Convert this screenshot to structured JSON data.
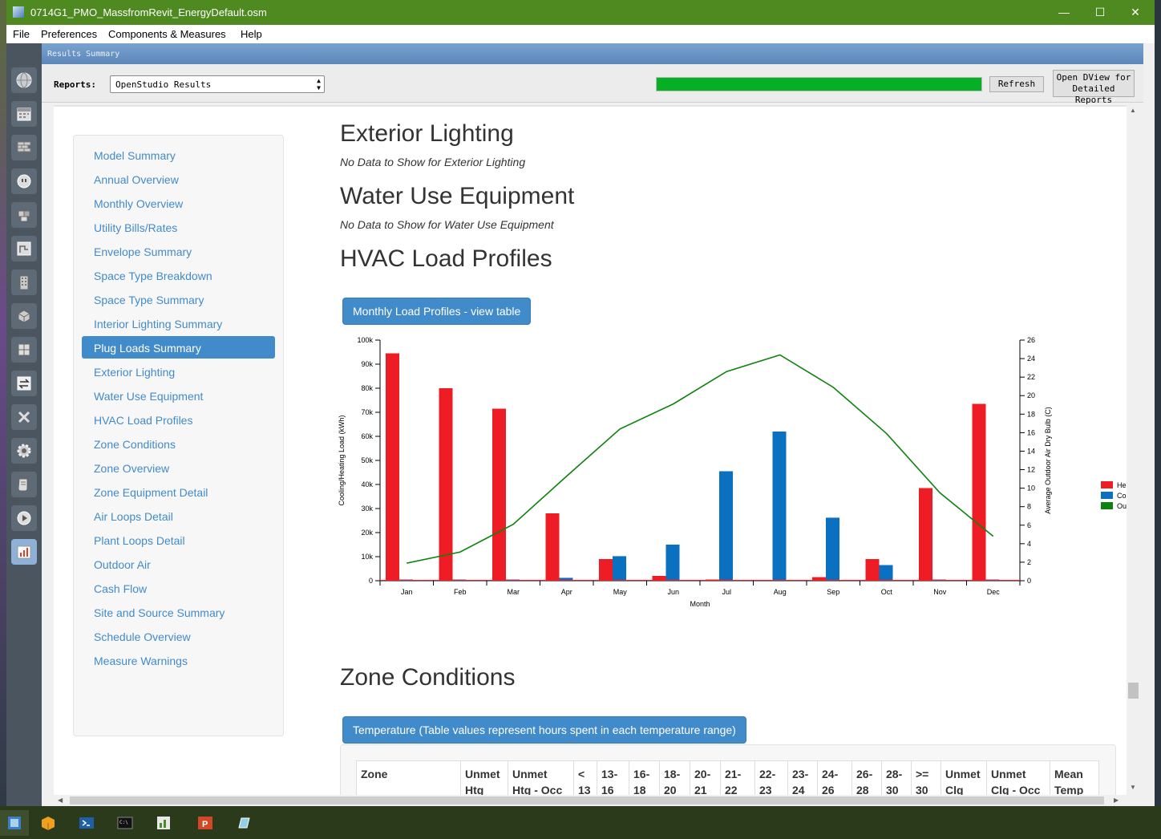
{
  "window": {
    "title": "0714G1_PMO_MassfromRevit_EnergyDefault.osm",
    "minimize": "—",
    "maximize": "☐",
    "close": "✕"
  },
  "menu": [
    "File",
    "Preferences",
    "Components & Measures",
    "Help"
  ],
  "panel_title": "Results Summary",
  "reports": {
    "label": "Reports:",
    "selected": "OpenStudio Results",
    "progress_percent": 100,
    "refresh": "Refresh",
    "dview_line1": "Open DView for",
    "dview_line2": "Detailed Reports"
  },
  "nav": [
    {
      "label": "Model Summary",
      "active": false
    },
    {
      "label": "Annual Overview",
      "active": false
    },
    {
      "label": "Monthly Overview",
      "active": false
    },
    {
      "label": "Utility Bills/Rates",
      "active": false
    },
    {
      "label": "Envelope Summary",
      "active": false
    },
    {
      "label": "Space Type Breakdown",
      "active": false
    },
    {
      "label": "Space Type Summary",
      "active": false
    },
    {
      "label": "Interior Lighting Summary",
      "active": false
    },
    {
      "label": "Plug Loads Summary",
      "active": true
    },
    {
      "label": "Exterior Lighting",
      "active": false
    },
    {
      "label": "Water Use Equipment",
      "active": false
    },
    {
      "label": "HVAC Load Profiles",
      "active": false
    },
    {
      "label": "Zone Conditions",
      "active": false
    },
    {
      "label": "Zone Overview",
      "active": false
    },
    {
      "label": "Zone Equipment Detail",
      "active": false
    },
    {
      "label": "Air Loops Detail",
      "active": false
    },
    {
      "label": "Plant Loops Detail",
      "active": false
    },
    {
      "label": "Outdoor Air",
      "active": false
    },
    {
      "label": "Cash Flow",
      "active": false
    },
    {
      "label": "Site and Source Summary",
      "active": false
    },
    {
      "label": "Schedule Overview",
      "active": false
    },
    {
      "label": "Measure Warnings",
      "active": false
    }
  ],
  "sections": {
    "exterior_lighting": {
      "title": "Exterior Lighting",
      "note": "No Data to Show for Exterior Lighting"
    },
    "water_use": {
      "title": "Water Use Equipment",
      "note": "No Data to Show for Water Use Equipment"
    },
    "hvac": {
      "title": "HVAC Load Profiles",
      "button": "Monthly Load Profiles - view table"
    },
    "zone_conditions": {
      "title": "Zone Conditions",
      "button": "Temperature (Table values represent hours spent in each temperature range)"
    }
  },
  "zone_table_headers": [
    [
      "Zone"
    ],
    [
      "Unmet",
      "Htg"
    ],
    [
      "Unmet",
      "Htg - Occ"
    ],
    [
      "<",
      "13"
    ],
    [
      "13-",
      "16"
    ],
    [
      "16-",
      "18"
    ],
    [
      "18-",
      "20"
    ],
    [
      "20-",
      "21"
    ],
    [
      "21-",
      "22"
    ],
    [
      "22-",
      "23"
    ],
    [
      "23-",
      "24"
    ],
    [
      "24-",
      "26"
    ],
    [
      "26-",
      "28"
    ],
    [
      "28-",
      "30"
    ],
    [
      ">=",
      "30"
    ],
    [
      "Unmet",
      "Clg"
    ],
    [
      "Unmet",
      "Clg - Occ"
    ],
    [
      "Mean",
      "Temp"
    ]
  ],
  "chart_data": {
    "type": "bar",
    "categories": [
      "Jan",
      "Feb",
      "Mar",
      "Apr",
      "May",
      "Jun",
      "Jul",
      "Aug",
      "Sep",
      "Oct",
      "Nov",
      "Dec"
    ],
    "series": [
      {
        "name": "He",
        "type": "bar",
        "color": "#ee1c24",
        "values": [
          94500,
          80000,
          71500,
          28000,
          9000,
          2000,
          500,
          0,
          1500,
          9000,
          38500,
          73500
        ]
      },
      {
        "name": "Co",
        "type": "bar",
        "color": "#0a70c0",
        "values": [
          500,
          500,
          500,
          1200,
          10200,
          15000,
          45500,
          62000,
          26200,
          6500,
          500,
          500
        ]
      },
      {
        "name": "Ou",
        "type": "line",
        "color": "#0e820e",
        "axis": "right",
        "values": [
          1.9,
          3.1,
          6.1,
          11.3,
          16.4,
          19.1,
          22.6,
          24.4,
          20.9,
          15.9,
          9.5,
          4.8
        ]
      }
    ],
    "xlabel": "Month",
    "ylabel": "Cooling/Heating Load (kWh)",
    "ylabel_right": "Average Outdoor Air Dry Bulb (C)",
    "ylim": [
      0,
      100000
    ],
    "ylim_right": [
      0,
      26
    ],
    "y_ticks": [
      "0",
      "10k",
      "20k",
      "30k",
      "40k",
      "50k",
      "60k",
      "70k",
      "80k",
      "90k",
      "100k"
    ],
    "y_right_ticks": [
      "0",
      "2",
      "4",
      "6",
      "8",
      "10",
      "12",
      "14",
      "16",
      "18",
      "20",
      "22",
      "24",
      "26"
    ],
    "legend": "right",
    "grid": false
  }
}
